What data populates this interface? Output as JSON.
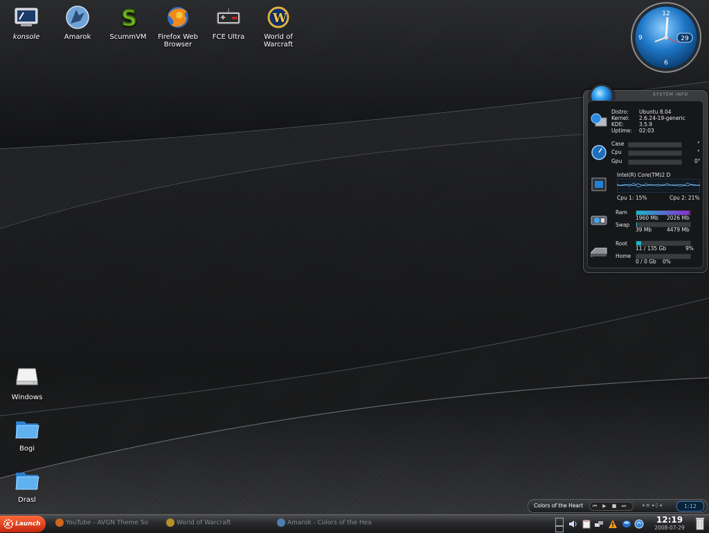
{
  "desktop": {
    "icons": [
      {
        "name": "konsole",
        "label": "konsole"
      },
      {
        "name": "amarok",
        "label": "Amarok"
      },
      {
        "name": "scummvm",
        "label": "ScummVM"
      },
      {
        "name": "firefox",
        "label": "Firefox Web Browser"
      },
      {
        "name": "fceultra",
        "label": "FCE Ultra"
      },
      {
        "name": "wow",
        "label": "World of Warcraft"
      },
      {
        "name": "windows",
        "label": "Windows"
      },
      {
        "name": "bogi",
        "label": "Bogi"
      },
      {
        "name": "drasl",
        "label": "Drasl"
      }
    ]
  },
  "clock": {
    "n12": "12",
    "n9": "9",
    "n6": "6",
    "date": "29"
  },
  "sysinfo": {
    "header": "SYSTEM INFO",
    "system": {
      "distro_label": "Distro:",
      "distro": "Ubuntu 8.04",
      "kernel_label": "Kernel:",
      "kernel": "2.6.24-19-generic",
      "kde_label": "KDE:",
      "kde": "3.5.9",
      "uptime_label": "Uptime:",
      "uptime": "02:03"
    },
    "temps": {
      "case_label": "Case",
      "case_value": "°",
      "cpu_label": "Cpu",
      "cpu_value": "°",
      "gpu_label": "Gpu",
      "gpu_value": "0°"
    },
    "cpu": {
      "model": "Intel(R) Core(TM)2 D",
      "cpu1": "Cpu 1: 15%",
      "cpu2": "Cpu 2: 21%",
      "graph1": [
        0.5,
        0.55,
        0.6,
        0.45,
        0.7,
        0.4,
        0.5,
        0.65,
        0.5,
        0.55,
        0.45,
        0.6,
        0.5,
        0.55,
        0.6,
        0.45,
        0.5,
        0.7,
        0.55,
        0.5,
        0.6
      ],
      "graph2": [
        0.6,
        0.5,
        0.55,
        0.6,
        0.5,
        0.65,
        0.55,
        0.5,
        0.6,
        0.55,
        0.6,
        0.5,
        0.65,
        0.55,
        0.5,
        0.6,
        0.55,
        0.5,
        0.6,
        0.55,
        0.5
      ]
    },
    "memory": {
      "ram_label": "Ram",
      "ram_used": "1960 Mb",
      "ram_total": "2026 Mb",
      "ram_fraction": 0.97,
      "swap_label": "Swap",
      "swap_used": "39 Mb",
      "swap_total": "4479 Mb",
      "swap_fraction": 0.01
    },
    "disks": {
      "root_label": "Root",
      "root_usage": "11 / 135 Gb",
      "root_percent": "9%",
      "root_fraction": 0.09,
      "home_label": "Home",
      "home_usage": "0 / 0 Gb",
      "home_percent": "0%",
      "home_fraction": 0
    },
    "colors": {
      "ram_start": "#19b6c9",
      "ram_end": "#8a2fd6",
      "disk": "#19b6c9"
    }
  },
  "player": {
    "song": "Colors of the Heart",
    "controls": [
      "⏮",
      "▶",
      "■",
      "⏭"
    ],
    "volume": "◂ ≡ ◂ ◊ ◂",
    "time": "1:12"
  },
  "taskbar": {
    "launch_label": "Launch",
    "tasks": [
      {
        "label": "YouTube - AVGN Theme So",
        "icon": "firefox-icon"
      },
      {
        "label": "World of Warcraft",
        "icon": "wow-icon"
      },
      {
        "label": "Amarok - Colors of the Hea",
        "icon": "amarok-icon"
      }
    ],
    "clock_time": "12:19",
    "clock_date": "2008-07-29"
  }
}
